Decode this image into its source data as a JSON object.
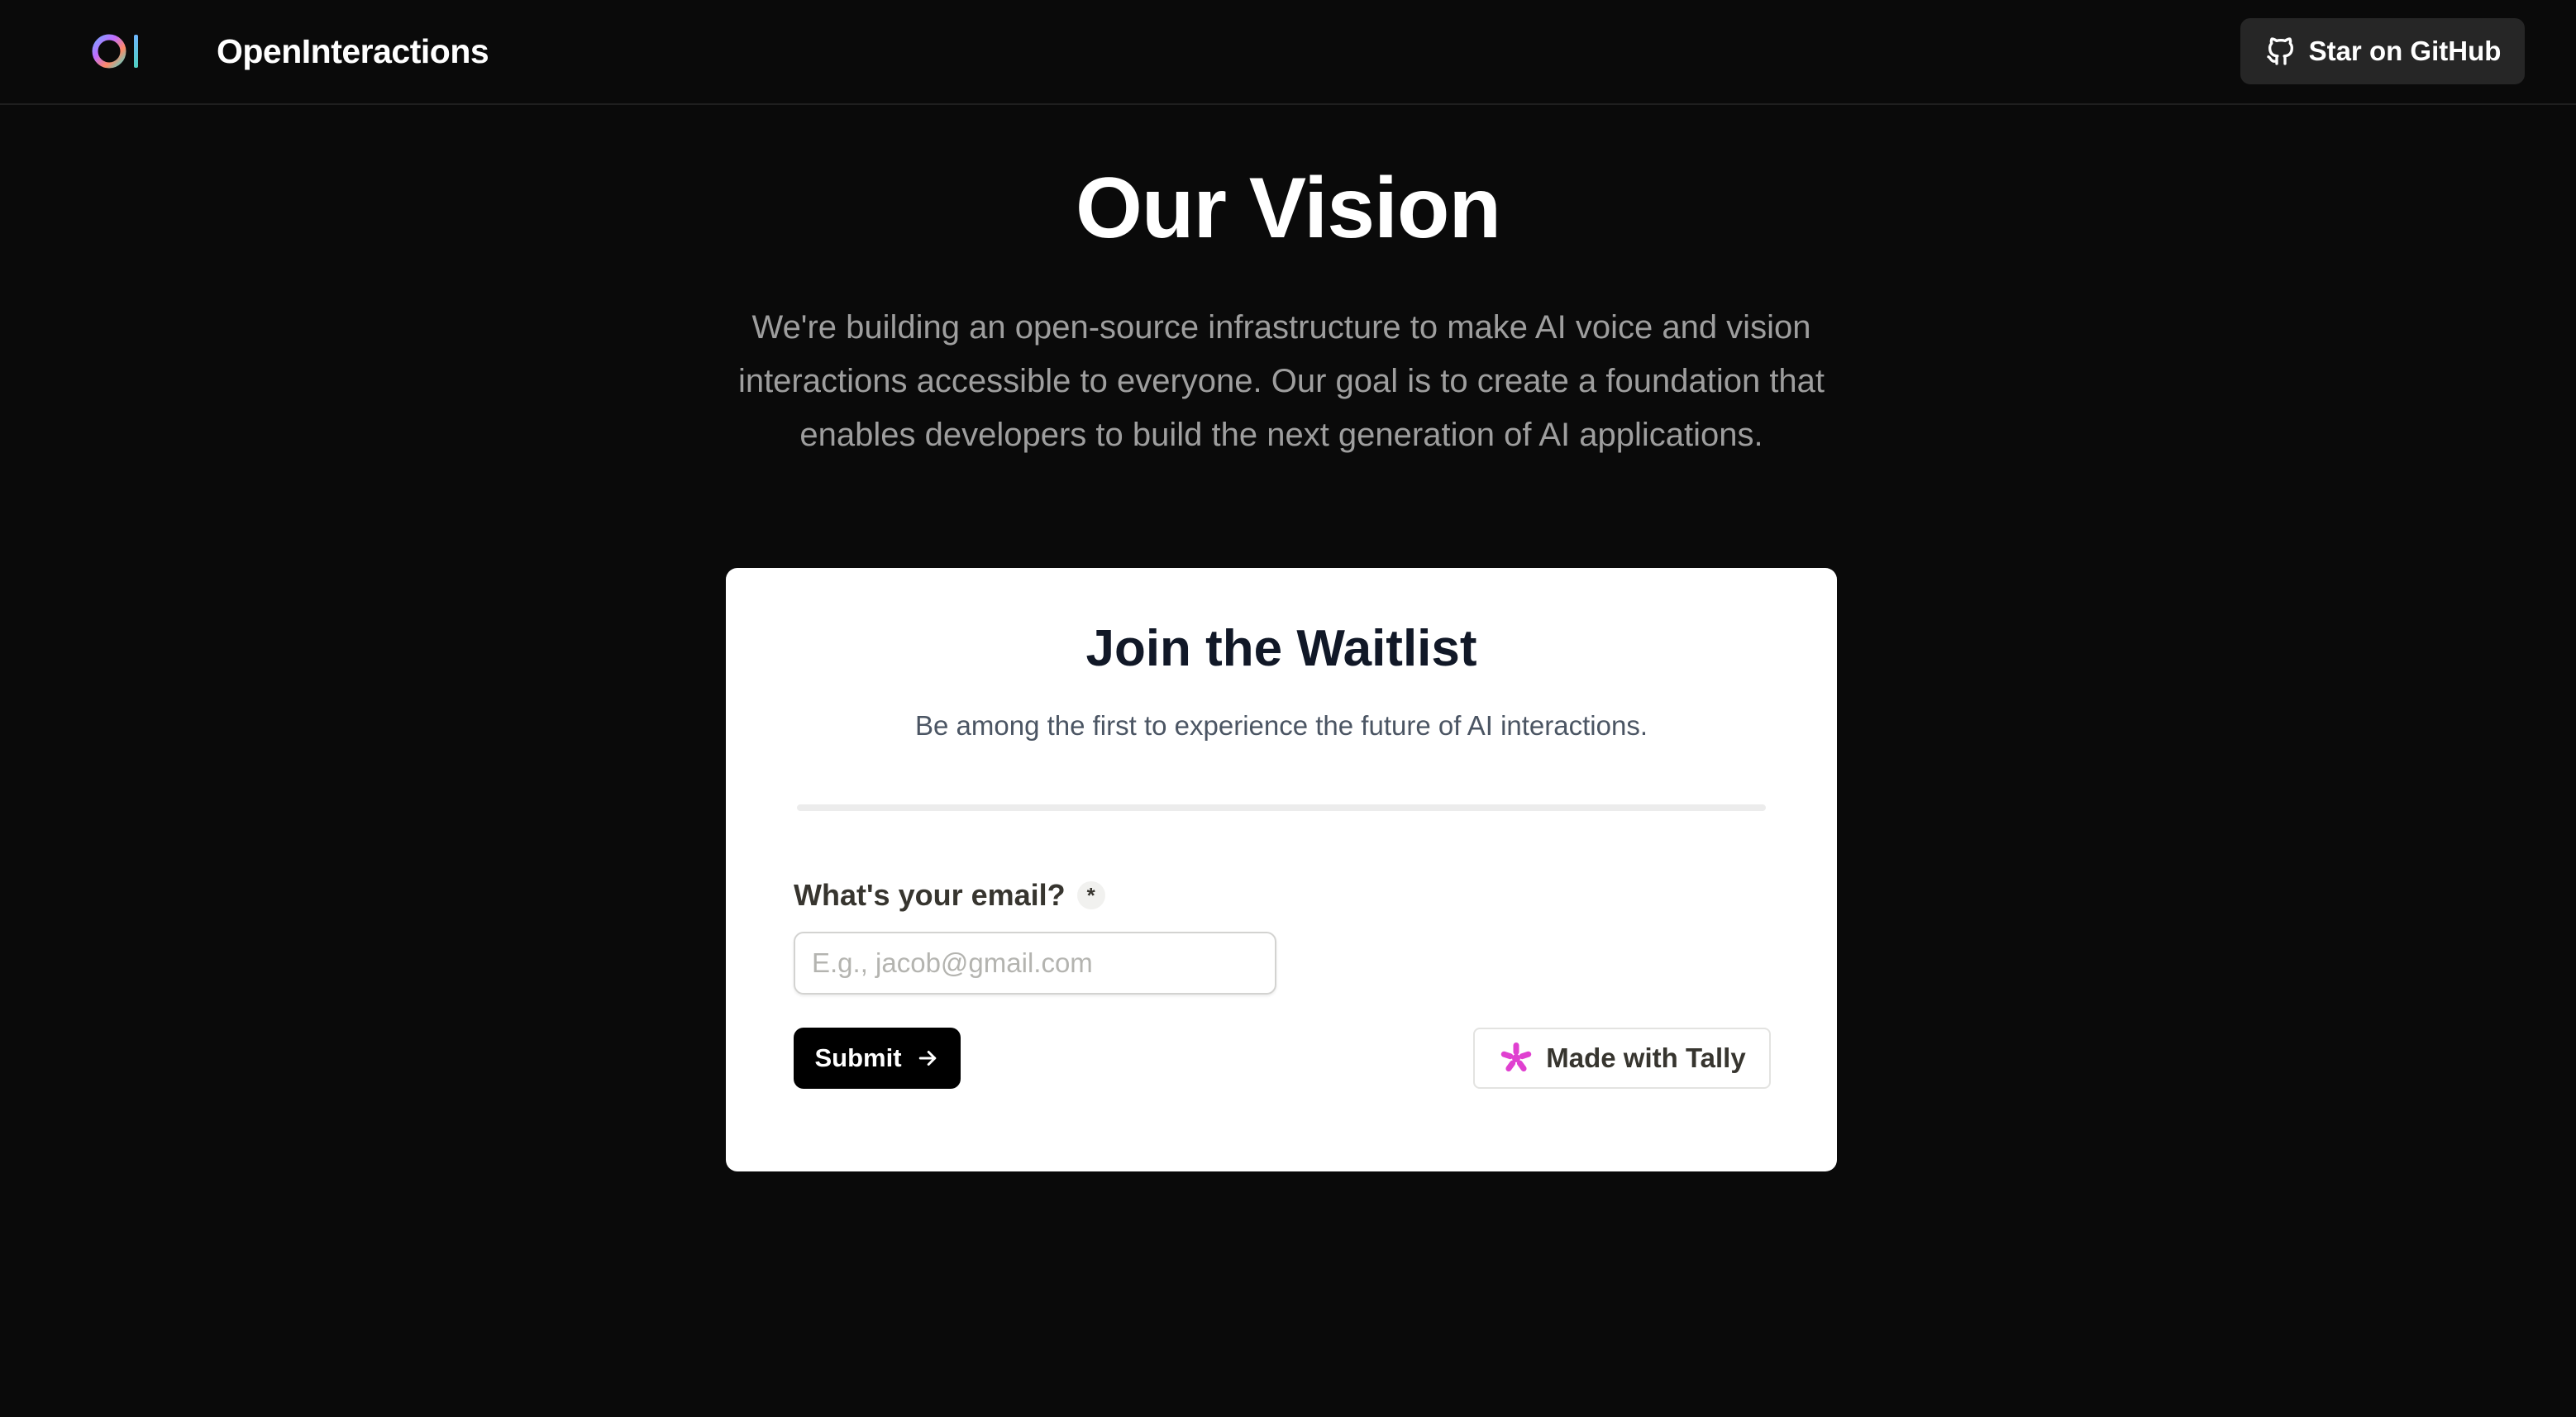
{
  "header": {
    "logo_icon": "openinteractions-logo-icon",
    "brand_name": "OpenInteractions",
    "github_button": {
      "icon": "github-icon",
      "label": "Star on GitHub"
    }
  },
  "hero": {
    "title": "Our Vision",
    "description": "We're building an open-source infrastructure to make AI voice and vision interactions accessible to everyone. Our goal is to create a foundation that enables developers to build the next generation of AI applications."
  },
  "waitlist": {
    "title": "Join the Waitlist",
    "subtitle": "Be among the first to experience the future of AI interactions.",
    "email_label": "What's your email?",
    "required_marker": "*",
    "email_placeholder": "E.g., jacob@gmail.com",
    "email_value": "",
    "submit_label": "Submit",
    "submit_icon": "arrow-right-icon",
    "tally_label": "Made with Tally",
    "tally_icon": "tally-asterisk-icon"
  },
  "colors": {
    "background": "#0a0a0a",
    "card_background": "#ffffff",
    "button_dark": "#000000",
    "github_button_bg": "#262626",
    "tally_accent": "#e040d0",
    "muted_text": "#9e9e9e"
  }
}
